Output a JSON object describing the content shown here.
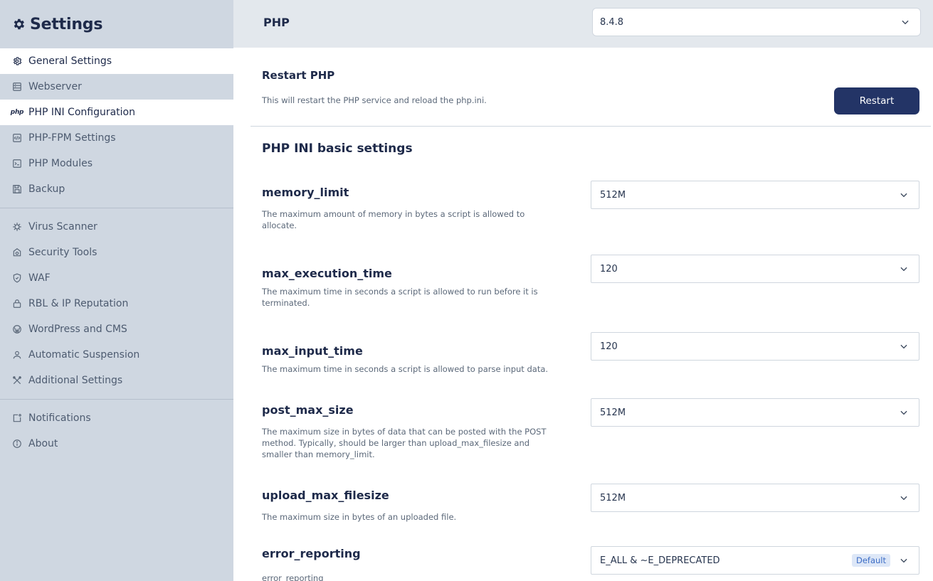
{
  "sidebar": {
    "title": "Settings",
    "items": [
      {
        "label": "General Settings",
        "icon": "gear-outline-icon"
      },
      {
        "label": "Webserver",
        "icon": "server-icon"
      },
      {
        "label": "PHP INI Configuration",
        "icon": "php-icon"
      },
      {
        "label": "PHP-FPM Settings",
        "icon": "code-window-icon"
      },
      {
        "label": "PHP Modules",
        "icon": "terminal-icon"
      },
      {
        "label": "Backup",
        "icon": "floppy-icon"
      },
      {
        "label": "Virus Scanner",
        "icon": "virus-icon"
      },
      {
        "label": "Security Tools",
        "icon": "security-camera-icon"
      },
      {
        "label": "WAF",
        "icon": "shield-icon"
      },
      {
        "label": "RBL & IP Reputation",
        "icon": "lock-icon"
      },
      {
        "label": "WordPress and CMS",
        "icon": "wordpress-icon"
      },
      {
        "label": "Automatic Suspension",
        "icon": "user-icon"
      },
      {
        "label": "Additional Settings",
        "icon": "tools-icon"
      },
      {
        "label": "Notifications",
        "icon": "notification-icon"
      },
      {
        "label": "About",
        "icon": "info-icon"
      }
    ],
    "php_mark": "php"
  },
  "topbar": {
    "label": "PHP",
    "version_value": "8.4.8"
  },
  "restart": {
    "title": "Restart PHP",
    "description": "This will restart the PHP service and reload the php.ini.",
    "button_label": "Restart"
  },
  "section": {
    "title": "PHP INI basic settings"
  },
  "settings": [
    {
      "name": "memory_limit",
      "description": "The maximum amount of memory in bytes a script is allowed to allocate.",
      "value": "512M"
    },
    {
      "name": "max_execution_time",
      "description": "The maximum time in seconds a script is allowed to run before it is terminated.",
      "value": "120"
    },
    {
      "name": "max_input_time",
      "description": "The maximum time in seconds a script is allowed to parse input data.",
      "value": "120"
    },
    {
      "name": "post_max_size",
      "description": "The maximum size in bytes of data that can be posted with the POST method. Typically, should be larger than upload_max_filesize and smaller than memory_limit.",
      "value": "512M"
    },
    {
      "name": "upload_max_filesize",
      "description": "The maximum size in bytes of an uploaded file.",
      "value": "512M"
    },
    {
      "name": "error_reporting",
      "description": "error_reporting",
      "value": "E_ALL & ~E_DEPRECATED",
      "badge": "Default"
    }
  ],
  "colors": {
    "sidebar_bg": "#cfd7e1",
    "accent": "#233466",
    "topbar_bg": "#e3e8ed",
    "badge_bg": "#dde7f7",
    "badge_text": "#3b6cc5"
  }
}
